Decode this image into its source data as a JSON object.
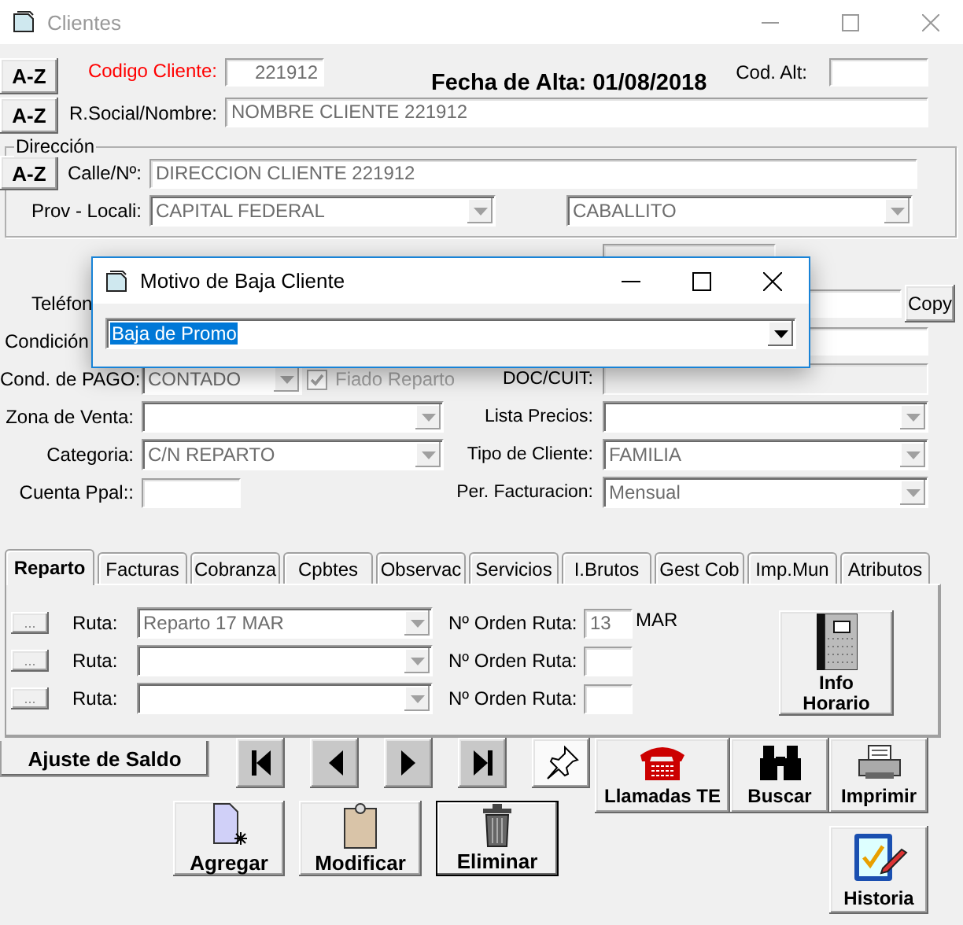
{
  "window": {
    "title": "Clientes"
  },
  "header": {
    "az_buttons": [
      "A-Z",
      "A-Z"
    ],
    "codigo_cliente": {
      "label": "Codigo Cliente:",
      "value": "221912"
    },
    "fecha_alta": "Fecha de Alta: 01/08/2018",
    "cod_alt": {
      "label": "Cod. Alt:"
    },
    "razon_social": {
      "label": "R.Social/Nombre:",
      "value": "NOMBRE CLIENTE 221912"
    }
  },
  "direccion": {
    "title": "Dirección",
    "az_button": "A-Z",
    "calle": {
      "label": "Calle/Nº:",
      "value": "DIRECCION CLIENTE 221912"
    },
    "prov_label": "Prov - Locali:",
    "provincia": "CAPITAL FEDERAL",
    "localidad": "CABALLITO"
  },
  "telefono": {
    "label": "Teléfon",
    "copy_button": "Copy"
  },
  "condicion": {
    "label": "Condición"
  },
  "rows": [
    {
      "left": {
        "label": "Cond. de PAGO:",
        "kind": "combo",
        "value": "CONTADO"
      },
      "check": {
        "label": "Fiado Reparto",
        "checked": true
      },
      "right": {
        "label": "DOC/CUIT:",
        "kind": "text"
      }
    },
    {
      "left": {
        "label": "Zona de Venta:",
        "kind": "combo"
      },
      "right": {
        "label": "Lista Precios:",
        "kind": "combo"
      }
    },
    {
      "left": {
        "label": "Categoria:",
        "kind": "combo",
        "value": "C/N REPARTO"
      },
      "right": {
        "label": "Tipo de Cliente:",
        "kind": "combo",
        "value": "FAMILIA"
      }
    },
    {
      "left": {
        "label": "Cuenta Ppal::",
        "kind": "text"
      },
      "right": {
        "label": "Per. Facturacion:",
        "kind": "combo",
        "value": "Mensual"
      }
    }
  ],
  "tabs": [
    {
      "label": "Reparto",
      "selected": true
    },
    {
      "label": "Facturas",
      "selected": false
    },
    {
      "label": "Cobranza",
      "selected": false
    },
    {
      "label": "Cpbtes",
      "selected": false
    },
    {
      "label": "Observac",
      "selected": false
    },
    {
      "label": "Servicios",
      "selected": false
    },
    {
      "label": "I.Brutos",
      "selected": false
    },
    {
      "label": "Gest Cob",
      "selected": false
    },
    {
      "label": "Imp.Mun",
      "selected": false
    },
    {
      "label": "Atributos",
      "selected": false
    }
  ],
  "rutas": [
    {
      "button": "...",
      "label": "Ruta:",
      "value": "Reparto 17 MAR",
      "orden_label": "Nº Orden Ruta:",
      "orden": "13",
      "suffix": "MAR"
    },
    {
      "button": "...",
      "label": "Ruta:",
      "orden_label": "Nº Orden Ruta:"
    },
    {
      "button": "...",
      "label": "Ruta:",
      "orden_label": "Nº Orden Ruta:"
    }
  ],
  "info_button": [
    "Info",
    "Horario"
  ],
  "ajuste_tab": "Ajuste de Saldo",
  "actions": [
    "Llamadas TE",
    "Buscar",
    "Imprimir"
  ],
  "edit_buttons": [
    {
      "label": "Agregar",
      "default": false
    },
    {
      "label": "Modificar",
      "default": false
    },
    {
      "label": "Eliminar",
      "default": true
    }
  ],
  "historia_button": "Historia",
  "dialog": {
    "title": "Motivo de Baja Cliente",
    "value": "Baja de Promo"
  }
}
